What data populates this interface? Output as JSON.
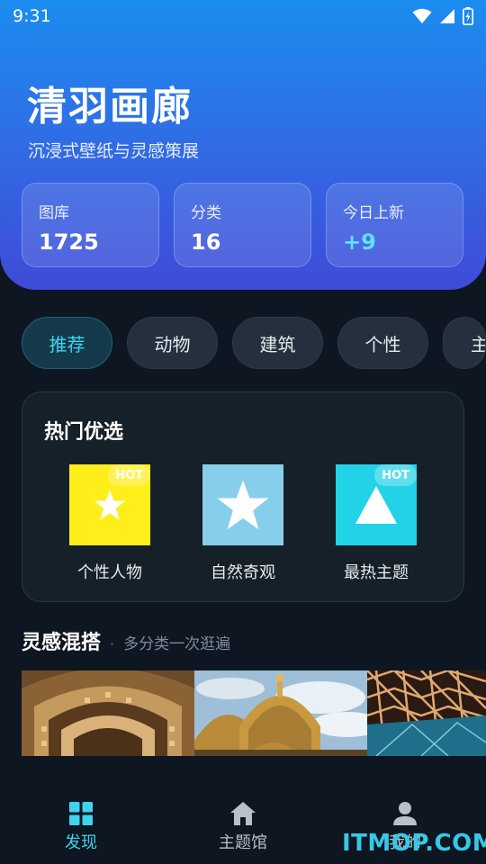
{
  "status_bar": {
    "time": "9:31"
  },
  "header": {
    "title": "清羽画廊",
    "subtitle": "沉浸式壁纸与灵感策展",
    "stats": [
      {
        "label": "图库",
        "value": "1725"
      },
      {
        "label": "分类",
        "value": "16"
      },
      {
        "label": "今日上新",
        "value": "+9",
        "accent_color": "#5ce1ff"
      }
    ]
  },
  "categories": {
    "chips": [
      "推荐",
      "动物",
      "建筑",
      "个性",
      "主"
    ],
    "selected": "推荐"
  },
  "hot_picks": {
    "title": "热门优选",
    "items": [
      {
        "label": "个性人物",
        "badge": "HOT",
        "color": "#ffee1a",
        "icon": "star-icon"
      },
      {
        "label": "自然奇观",
        "badge": "",
        "color": "#87ceeb",
        "icon": "star-icon"
      },
      {
        "label": "最热主题",
        "badge": "HOT",
        "color": "#22d3e8",
        "icon": "triangle-icon"
      }
    ]
  },
  "mix": {
    "title": "灵感混搭",
    "separator": "·",
    "subtitle": "多分类一次逛遍"
  },
  "bottom_nav": {
    "items": [
      {
        "label": "发现",
        "icon": "grid-icon",
        "active": true
      },
      {
        "label": "主题馆",
        "icon": "home-icon",
        "active": false
      },
      {
        "label": "我的",
        "icon": "user-icon",
        "active": false
      }
    ]
  },
  "watermark": "ITMOP.COM",
  "colors": {
    "accent": "#3fd3ee",
    "background": "#0e1621"
  }
}
